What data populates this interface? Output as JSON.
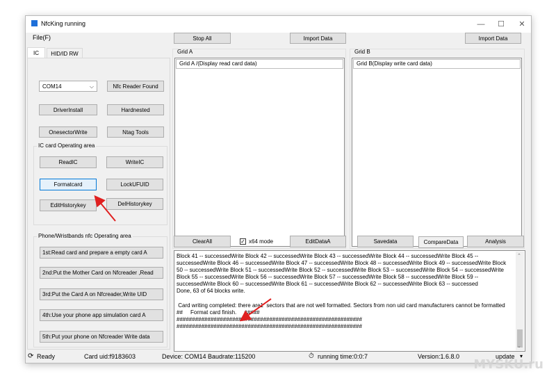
{
  "window": {
    "title": "NfcKing running",
    "minimize": "—",
    "maximize": "☐",
    "close": "✕"
  },
  "menu": {
    "file": "File(F)"
  },
  "toolbar": {
    "stop_all": "Stop All",
    "import_a": "Import Data",
    "import_b": "Import Data"
  },
  "tabs": [
    {
      "label": "IC"
    },
    {
      "label": "HID/ID RW"
    }
  ],
  "ic": {
    "com_port": "COM14",
    "reader_status": "Nfc Reader Found",
    "driver_install": "DriverInstall",
    "hardnested": "Hardnested",
    "onesector_write": "OnesectorWrite",
    "ntag_tools": "Ntag Tools",
    "operating_area_label": "IC card Operating area",
    "read_ic": "ReadIC",
    "write_ic": "WriteIC",
    "format_card": "Formatcard",
    "lock_ufuid": "LockUFUID",
    "edit_history_key": "EditHistorykey",
    "del_history_key": "DelHistorykey"
  },
  "phone": {
    "label": "Phone/Wristbands nfc Operating area",
    "steps": [
      "1st:Read card and prepare a empty card A",
      "2nd:Put the Mother Card on Nfcreader ,Read",
      "3rd:Put the Card A on Nfcreader,Write UID",
      "4th:Use your phone app simulation card A",
      "5th:Put your phone on Nfcreader Write data"
    ]
  },
  "grid_a": {
    "label": "Grid A",
    "header": "Grid A /(Display read card data)",
    "clear_all": "ClearAll",
    "x64_mode": "x64 mode",
    "x64_checked": "✓",
    "edit_data_a": "EditDataA"
  },
  "grid_b": {
    "label": "Grid B",
    "header": "Grid B(Display write card data)",
    "save_data": "Savedata",
    "compare_data": "CompareData",
    "analysis": "Analysis"
  },
  "log": {
    "lines": [
      "Block 41 -- successedWrite Block 42 -- successedWrite Block 43 -- successedWrite Block 44 -- successedWrite Block 45 -- successedWrite Block 46 -- successedWrite Block 47 -- successedWrite Block 48 -- successedWrite Block 49 -- successedWrite Block 50 -- successedWrite Block 51 -- successedWrite Block 52 -- successedWrite Block 53 -- successedWrite Block 54 -- successedWrite Block 55 -- successedWrite Block 56 -- successedWrite Block 57 -- successedWrite Block 58 -- successedWrite Block 59 -- successedWrite Block 60 -- successedWrite Block 61 -- successedWrite Block 62 -- successedWrite Block 63 -- successed",
      "Done, 63 of 64 blocks write.",
      "",
      " Card writing completed: there are1  sectors that are not well formatted. Sectors from non uid card manufacturers cannot be formatted",
      "##     Format card finish.     #####",
      "############################################################",
      "############################################################"
    ]
  },
  "status": {
    "ready": "Ready",
    "card_uid": "Card uid:f9183603",
    "device": "Device: COM14  Baudrate:115200",
    "running_time": "running time:0:0:7",
    "version": "Version:1.6.8.0",
    "update": "update"
  },
  "watermark": "MYSKU.ru"
}
